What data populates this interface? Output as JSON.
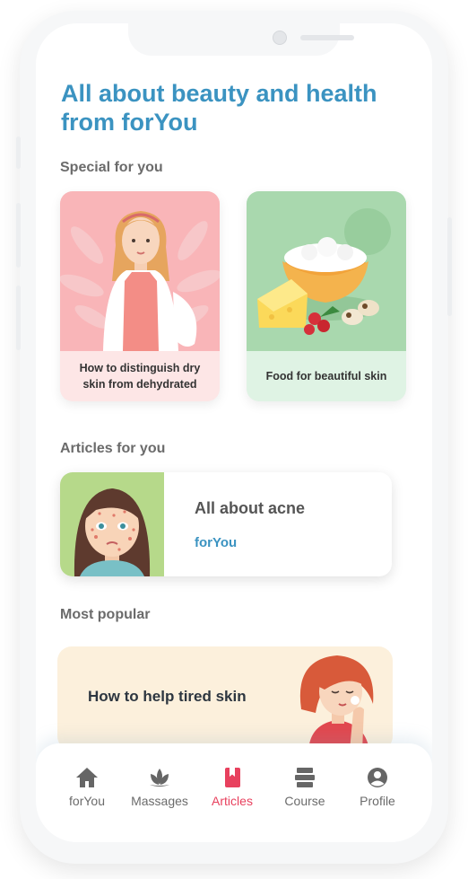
{
  "header": {
    "title": "All about beauty and health from forYou"
  },
  "special": {
    "heading": "Special for you",
    "cards": [
      {
        "caption": "How to distinguish dry skin from dehydrated"
      },
      {
        "caption": "Food for beautiful skin"
      }
    ]
  },
  "articles": {
    "heading": "Articles for you",
    "items": [
      {
        "title": "All about acne",
        "source": "forYou"
      }
    ]
  },
  "popular": {
    "heading": "Most popular",
    "items": [
      {
        "title": "How to help tired skin"
      }
    ]
  },
  "tabbar": {
    "active_color": "#e8415e",
    "inactive_color": "#6b6b6b",
    "items": [
      {
        "label": "forYou",
        "icon": "home-icon"
      },
      {
        "label": "Massages",
        "icon": "lotus-icon"
      },
      {
        "label": "Articles",
        "icon": "bookmark-icon",
        "active": true
      },
      {
        "label": "Course",
        "icon": "stack-icon"
      },
      {
        "label": "Profile",
        "icon": "user-icon"
      }
    ]
  },
  "colors": {
    "accent_blue": "#3b93c1",
    "accent_red": "#e8415e"
  }
}
